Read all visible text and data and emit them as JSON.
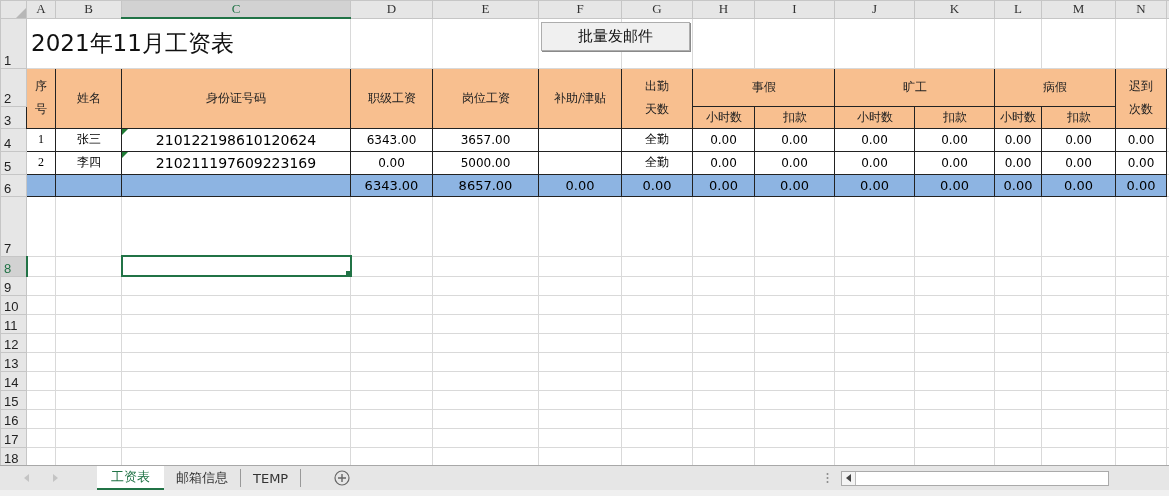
{
  "columns": [
    {
      "label": "A",
      "selected": false
    },
    {
      "label": "B",
      "selected": false
    },
    {
      "label": "C",
      "selected": true
    },
    {
      "label": "D",
      "selected": false
    },
    {
      "label": "E",
      "selected": false
    },
    {
      "label": "F",
      "selected": false
    },
    {
      "label": "G",
      "selected": false
    },
    {
      "label": "H",
      "selected": false
    },
    {
      "label": "I",
      "selected": false
    },
    {
      "label": "J",
      "selected": false
    },
    {
      "label": "K",
      "selected": false
    },
    {
      "label": "L",
      "selected": false
    },
    {
      "label": "M",
      "selected": false
    },
    {
      "label": "N",
      "selected": false
    }
  ],
  "rows": [
    {
      "label": "1",
      "selected": false
    },
    {
      "label": "2",
      "selected": false
    },
    {
      "label": "3",
      "selected": false
    },
    {
      "label": "4",
      "selected": false
    },
    {
      "label": "5",
      "selected": false
    },
    {
      "label": "6",
      "selected": false
    },
    {
      "label": "7",
      "selected": false
    },
    {
      "label": "8",
      "selected": true
    },
    {
      "label": "9",
      "selected": false
    },
    {
      "label": "10",
      "selected": false
    },
    {
      "label": "11",
      "selected": false
    },
    {
      "label": "12",
      "selected": false
    },
    {
      "label": "13",
      "selected": false
    },
    {
      "label": "14",
      "selected": false
    },
    {
      "label": "15",
      "selected": false
    },
    {
      "label": "16",
      "selected": false
    },
    {
      "label": "17",
      "selected": false
    },
    {
      "label": "18",
      "selected": false
    }
  ],
  "title": "2021年11月工资表",
  "button": "批量发邮件",
  "headers": [
    {
      "label": "序号",
      "kind": "stacked"
    },
    {
      "label": "姓名",
      "kind": "plain"
    },
    {
      "label": "身份证号码",
      "kind": "plain"
    },
    {
      "label": "职级工资",
      "kind": "plain"
    },
    {
      "label": "岗位工资",
      "kind": "plain"
    },
    {
      "label": "补助/津贴",
      "kind": "plain"
    },
    {
      "label": "出勤天数",
      "kind": "stacked"
    },
    {
      "label": "事假",
      "kind": "group",
      "children": [
        "小时数",
        "扣款"
      ]
    },
    {
      "label": "旷工",
      "kind": "group",
      "children": [
        "小时数",
        "扣款"
      ]
    },
    {
      "label": "病假",
      "kind": "group",
      "children": [
        "小时数",
        "扣款"
      ]
    },
    {
      "label": "迟到次数",
      "kind": "stacked"
    }
  ],
  "data_rows": [
    {
      "flagged": true,
      "cells": [
        "1",
        "张三",
        "210122198610120624",
        "6343.00",
        "3657.00",
        null,
        "全勤",
        "0.00",
        "0.00",
        "0.00",
        "0.00",
        "0.00",
        "0.00",
        "0.00"
      ]
    },
    {
      "flagged": true,
      "cells": [
        "2",
        "李四",
        "210211197609223169",
        "0.00",
        "5000.00",
        null,
        "全勤",
        "0.00",
        "0.00",
        "0.00",
        "0.00",
        "0.00",
        "0.00",
        "0.00"
      ]
    }
  ],
  "total_row": [
    "6343.00",
    "8657.00",
    "0.00",
    "0.00",
    "0.00",
    "0.00",
    "0.00",
    "0.00",
    "0.00",
    "0.00",
    "0.00"
  ],
  "sheet_tabs": [
    {
      "label": "工资表",
      "selected": true
    },
    {
      "label": "邮箱信息",
      "selected": false
    },
    {
      "label": "TEMP",
      "selected": false
    }
  ]
}
